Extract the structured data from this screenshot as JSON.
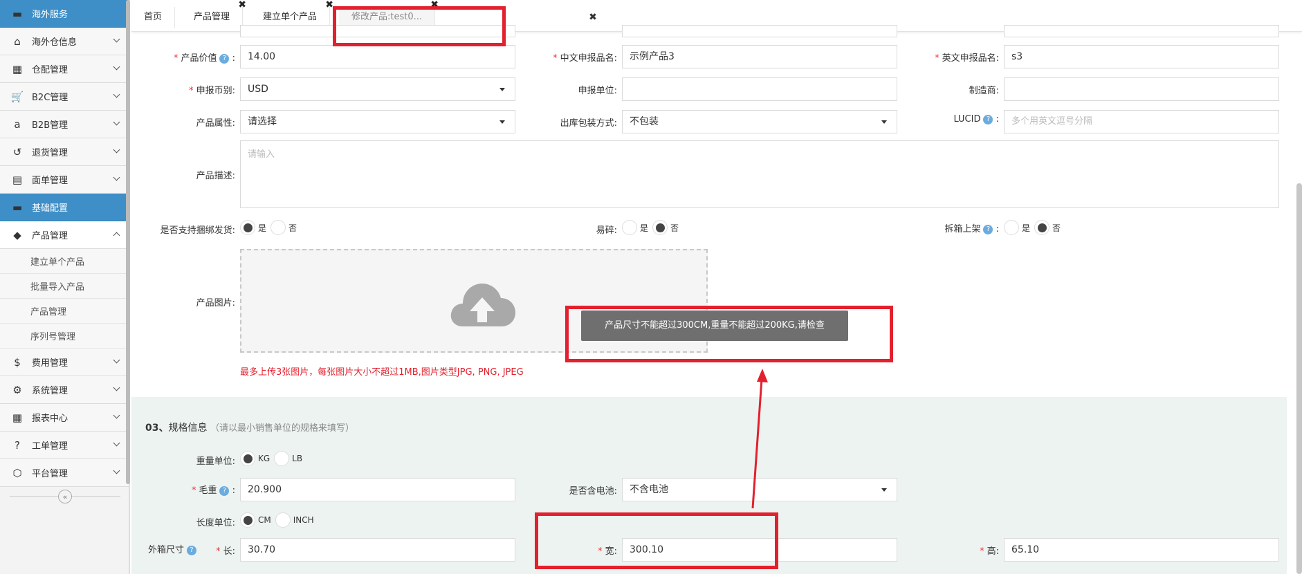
{
  "sidebar": {
    "items": [
      {
        "label": "海外服务",
        "icon": "folder-icon"
      },
      {
        "label": "海外仓信息",
        "icon": "home-icon"
      },
      {
        "label": "仓配管理",
        "icon": "grid-icon"
      },
      {
        "label": "B2C管理",
        "icon": "cart-icon"
      },
      {
        "label": "B2B管理",
        "icon": "amazon-icon"
      },
      {
        "label": "退货管理",
        "icon": "undo-icon"
      },
      {
        "label": "面单管理",
        "icon": "document-icon"
      },
      {
        "label": "基础配置",
        "icon": "folder-icon"
      },
      {
        "label": "产品管理",
        "icon": "tag-icon"
      },
      {
        "label": "费用管理",
        "icon": "dollar-icon"
      },
      {
        "label": "系统管理",
        "icon": "gear-icon"
      },
      {
        "label": "报表中心",
        "icon": "table-icon"
      },
      {
        "label": "工单管理",
        "icon": "question-icon"
      },
      {
        "label": "平台管理",
        "icon": "codepen-icon"
      }
    ],
    "sub_items": [
      "建立单个产品",
      "批量导入产品",
      "产品管理",
      "序列号管理"
    ],
    "collapse_label": "«"
  },
  "tabs": [
    {
      "label": "首页"
    },
    {
      "label": "产品管理"
    },
    {
      "label": "建立单个产品"
    },
    {
      "label": "修改产品:test0..."
    }
  ],
  "tab_close_glyph": "✖",
  "form": {
    "product_value_label": "产品价值",
    "product_value": "14.00",
    "cn_name_label": "中文申报品名:",
    "cn_name": "示例产品3",
    "en_name_label": "英文申报品名:",
    "en_name": "s3",
    "currency_label": "申报币别:",
    "currency": "USD",
    "declare_unit_label": "申报单位:",
    "declare_unit": "",
    "manufacturer_label": "制造商:",
    "manufacturer": "",
    "attr_label": "产品属性:",
    "attr": "请选择",
    "pack_label": "出库包装方式:",
    "pack": "不包装",
    "lucid_label": "LUCID",
    "lucid_placeholder": "多个用英文逗号分隔",
    "desc_label": "产品描述:",
    "desc_placeholder": "请输入",
    "bundle_label": "是否支持捆绑发货:",
    "fragile_label": "易碎:",
    "unbox_label": "拆箱上架",
    "yes": "是",
    "no": "否",
    "image_label": "产品图片:",
    "image_hint": "最多上传3张图片，每张图片大小不超过1MB,图片类型JPG, PNG, JPEG"
  },
  "spec": {
    "num": "03、",
    "title": "规格信息",
    "subtitle": "（请以最小销售单位的规格来填写）",
    "weight_unit_label": "重量单位:",
    "kg": "KG",
    "lb": "LB",
    "gross_label": "毛重",
    "gross": "20.900",
    "battery_label": "是否含电池:",
    "battery": "不含电池",
    "length_unit_label": "长度单位:",
    "cm": "CM",
    "inch": "INCH",
    "box_label": "外箱尺寸",
    "length_label": "长:",
    "length": "30.70",
    "width_label": "宽:",
    "width": "300.10",
    "height_label": "高:",
    "height": "65.10"
  },
  "toast": "产品尺寸不能超过300CM,重量不能超过200KG,请检查",
  "colors": {
    "annotation_red": "#e3202d",
    "sidebar_blue": "#3e8fc7"
  }
}
